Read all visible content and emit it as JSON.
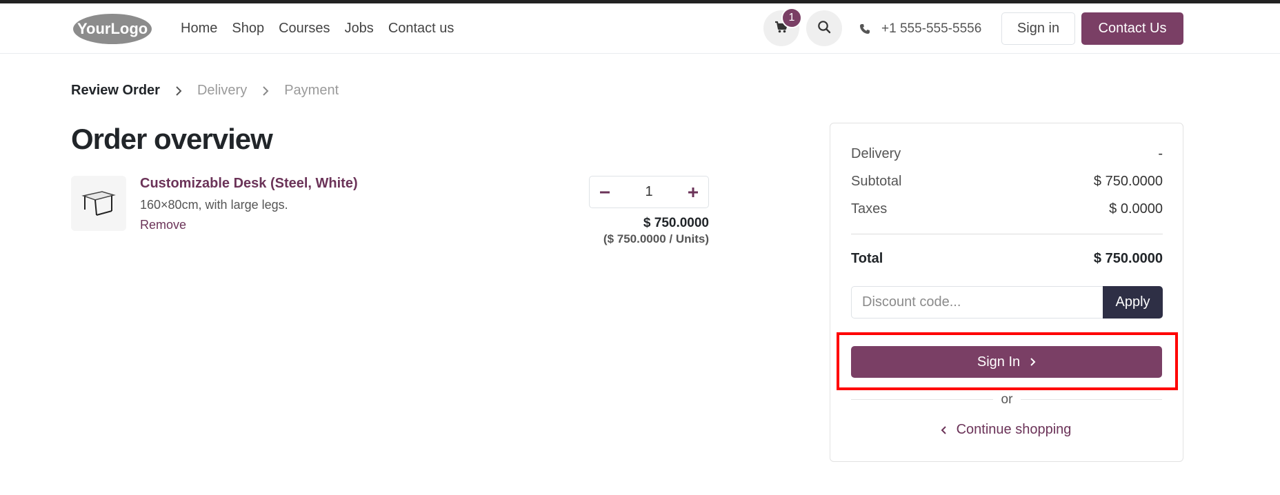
{
  "header": {
    "logo_text": "YourLogo",
    "nav": [
      "Home",
      "Shop",
      "Courses",
      "Jobs",
      "Contact us"
    ],
    "cart_count": "1",
    "phone": "+1 555-555-5556",
    "signin_label": "Sign in",
    "contact_label": "Contact Us",
    "accent_color": "#7a3f65"
  },
  "breadcrumb": {
    "steps": [
      "Review Order",
      "Delivery",
      "Payment"
    ]
  },
  "page": {
    "title": "Order overview"
  },
  "product": {
    "name": "Customizable Desk (Steel, White)",
    "description": "160×80cm, with large legs.",
    "remove_label": "Remove",
    "quantity": "1",
    "price": "$ 750.0000",
    "unit_price": "($ 750.0000 / Units)"
  },
  "summary": {
    "delivery_label": "Delivery",
    "delivery_value": "-",
    "subtotal_label": "Subtotal",
    "subtotal_value": "$ 750.0000",
    "taxes_label": "Taxes",
    "taxes_value": "$ 0.0000",
    "total_label": "Total",
    "total_value": "$ 750.0000",
    "discount_placeholder": "Discount code...",
    "apply_label": "Apply",
    "signin_label": "Sign In",
    "or_label": "or",
    "continue_label": "Continue shopping"
  }
}
